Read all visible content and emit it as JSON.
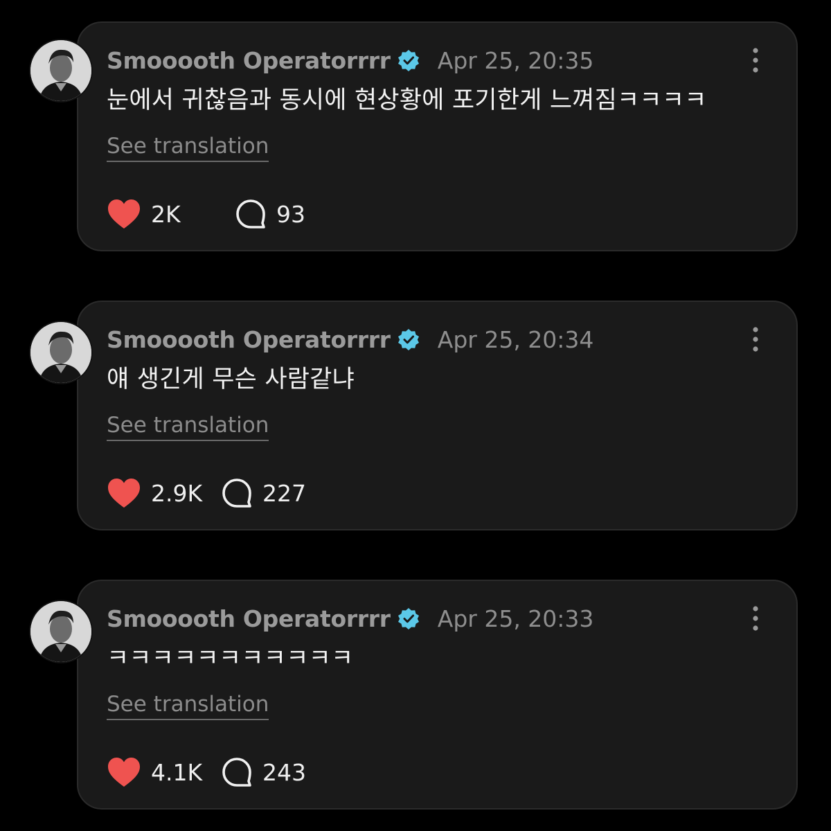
{
  "posts": [
    {
      "username": "Smooooth Operatorrrr",
      "verified": true,
      "timestamp": "Apr 25, 20:35",
      "text": "눈에서 귀찮음과 동시에 현상황에 포기한게 느껴짐ㅋㅋㅋㅋ",
      "translate_label": "See translation",
      "likes": "2K",
      "replies": "93"
    },
    {
      "username": "Smooooth Operatorrrr",
      "verified": true,
      "timestamp": "Apr 25, 20:34",
      "text": "얘 생긴게 무슨 사람같냐",
      "translate_label": "See translation",
      "likes": "2.9K",
      "replies": "227"
    },
    {
      "username": "Smooooth Operatorrrr",
      "verified": true,
      "timestamp": "Apr 25, 20:33",
      "text": "ㅋㅋㅋㅋㅋㅋㅋㅋㅋㅋㅋ",
      "translate_label": "See translation",
      "likes": "4.1K",
      "replies": "243"
    }
  ],
  "colors": {
    "background": "#000000",
    "card": "#1a1a1a",
    "card_border": "#2b2b2b",
    "heart": "#ef5350",
    "verified": "#5bc8e8",
    "username": "#9b9b9b",
    "text": "#f2f2f2"
  },
  "icons": {
    "avatar": "profile-photo",
    "verified": "verified-badge-icon",
    "more": "more-vertical-icon",
    "like": "heart-icon",
    "reply": "speech-bubble-icon"
  }
}
